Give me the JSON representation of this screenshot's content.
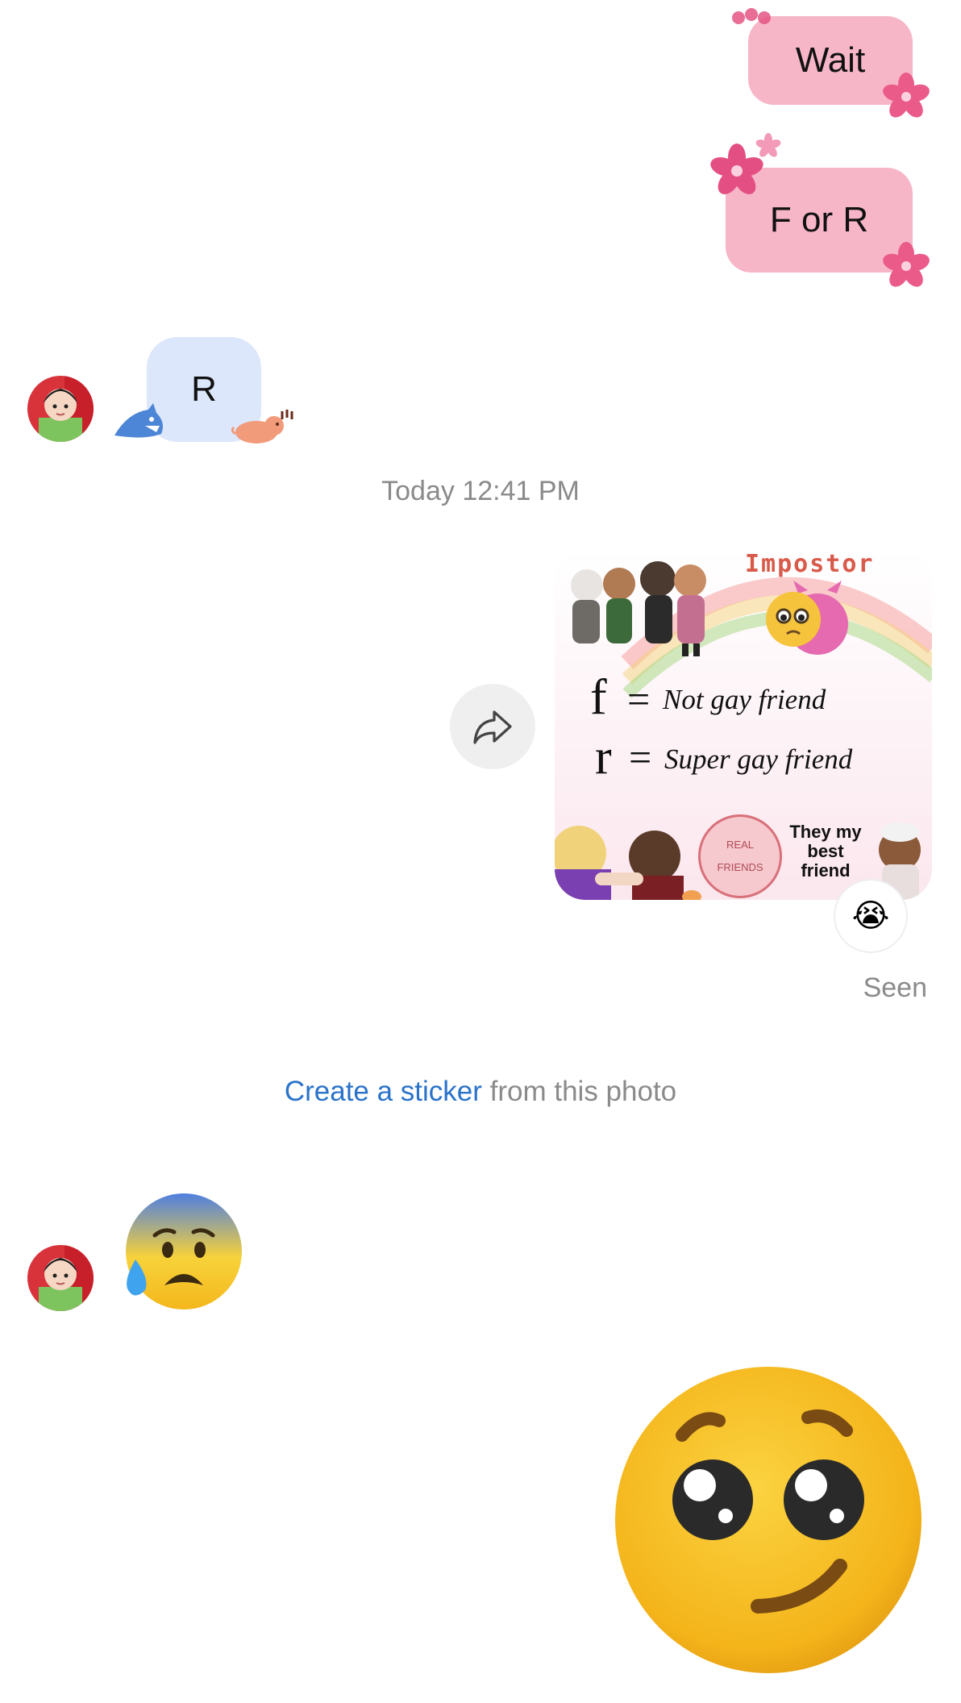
{
  "messages": {
    "out_1": "Wait",
    "out_2": "F or R",
    "in_1": "R"
  },
  "timestamp": "Today 12:41 PM",
  "photo": {
    "title": "Impostor",
    "line_f_symbol": "f",
    "line_f_text": "Not gay friend",
    "line_r_symbol": "r",
    "line_r_text": "Super gay friend",
    "badge": "REAL FRIENDS",
    "caption": "They my best friend"
  },
  "reaction_emoji": "😭",
  "status": "Seen",
  "sticker_prompt": {
    "link": "Create a sticker",
    "rest": " from this photo"
  },
  "incoming_emoji_icon": "anxious-face-with-sweat-icon",
  "outgoing_emoji_icon": "pleading-smirk-face-icon",
  "colors": {
    "outgoing_bubble": "#f7b6c8",
    "incoming_bubble": "#dce7fb",
    "link": "#2a73c9",
    "meta_text": "#8a8a8a"
  }
}
